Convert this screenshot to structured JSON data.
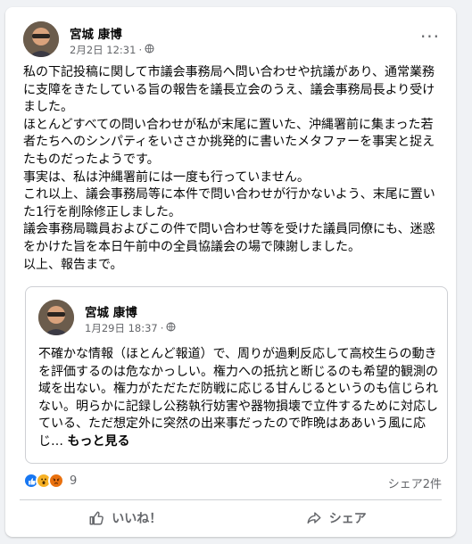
{
  "post": {
    "author": "宮城 康博",
    "date": "2月2日 12:31",
    "privacy_icon": "globe-icon",
    "more_icon": "more-options-icon",
    "paragraphs": [
      "私の下記投稿に関して市議会事務局へ問い合わせや抗議があり、通常業務に支障をきたしている旨の報告を議長立会のうえ、議会事務局長より受けました。",
      "ほとんどすべての問い合わせが私が末尾に置いた、沖縄署前に集まった若者たちへのシンパティをいささか挑発的に書いたメタファーを事実と捉えたものだったようです。",
      "事実は、私は沖縄署前には一度も行っていません。",
      "これ以上、議会事務局等に本件で問い合わせが行かないよう、末尾に置いた1行を削除修正しました。",
      "議会事務局職員およびこの件で問い合わせ等を受けた議員同僚にも、迷惑をかけた旨を本日午前中の全員協議会の場で陳謝しました。",
      "以上、報告まで。"
    ]
  },
  "shared": {
    "author": "宮城 康博",
    "date": "1月29日 18:37",
    "text": "不確かな情報（ほとんど報道）で、周りが過剰反応して高校生らの動きを評価するのは危なかっしい。権力への抵抗と断じるのも希望的観測の域を出ない。権力がただただ防戦に応じる甘んじるというのも信じられない。明らかに記録し公務執行妨害や器物損壊で立件するために対応している、ただ想定外に突然の出来事だったので昨晩はああいう風に応じ…",
    "see_more": "もっと見る"
  },
  "engagement": {
    "reaction_count": "9",
    "shares": "シェア2件",
    "reactions": [
      "like",
      "wow",
      "angry"
    ]
  },
  "actions": {
    "like_label": "いいね！",
    "share_label": "シェア"
  },
  "colors": {
    "like_blue": "#1877f2",
    "secondary_text": "#65676b",
    "background": "#f0f2f5"
  }
}
